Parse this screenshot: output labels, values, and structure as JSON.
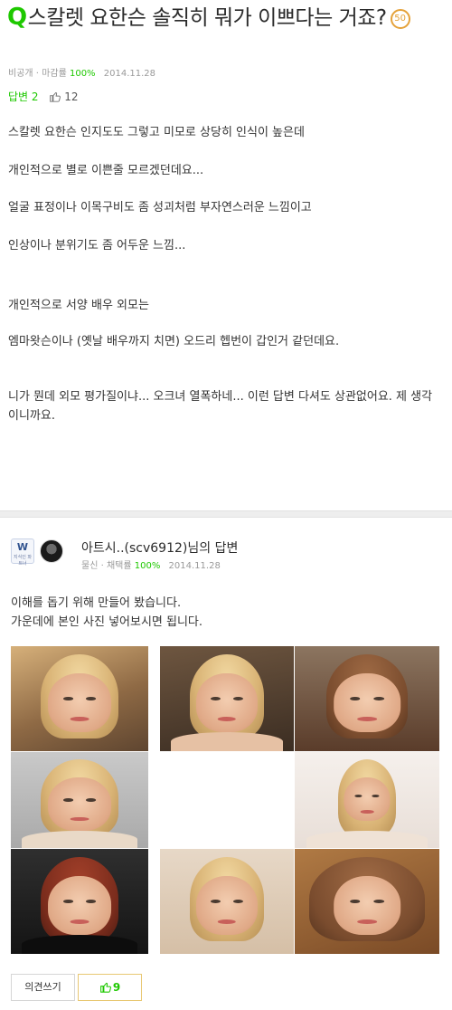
{
  "question": {
    "q_mark": "Q",
    "title": "스칼렛 요한슨 솔직히 뭐가 이쁘다는 거죠?",
    "points": "50",
    "meta": {
      "visibility": "비공개",
      "close_rate_label": "마감률",
      "close_rate": "100%",
      "date": "2014.11.28"
    },
    "stats": {
      "answers_label": "답변 2",
      "likes": "12"
    },
    "body": [
      "스칼렛 요한슨 인지도도 그렇고 미모로 상당히 인식이 높은데",
      "개인적으로 별로 이쁜줄 모르겠던데요...",
      "얼굴 표정이나 이목구비도 좀 성괴처럼 부자연스러운 느낌이고",
      "인상이나 분위기도 좀 어두운 느낌...",
      "개인적으로 서양 배우 외모는",
      "엠마왓슨이나 (옛날 배우까지 치면) 오드리 헵번이 갑인거 같던데요.",
      "니가 뭔데 외모 평가질이냐... 오크녀 열폭하네... 이런 답변 다셔도 상관없어요. 제 생각이니까요."
    ]
  },
  "answer": {
    "badge_letter": "W",
    "badge_text": "지식인 파트너",
    "author_line": "아트시..(scv6912)님의 답변",
    "meta": {
      "rank": "물신",
      "adopt_label": "채택률",
      "adopt_rate": "100%",
      "date": "2014.11.28"
    },
    "text": [
      "이해를 돕기 위해 만들어 봤습니다.",
      "가운데에 본인 사진 넣어보시면 됩니다."
    ]
  },
  "footer": {
    "opinion_button": "의견쓰기",
    "like_count": "9"
  },
  "colors": {
    "accent_green": "#1ec800",
    "points_orange": "#e5a23a",
    "meta_gray": "#9a9a9a"
  }
}
